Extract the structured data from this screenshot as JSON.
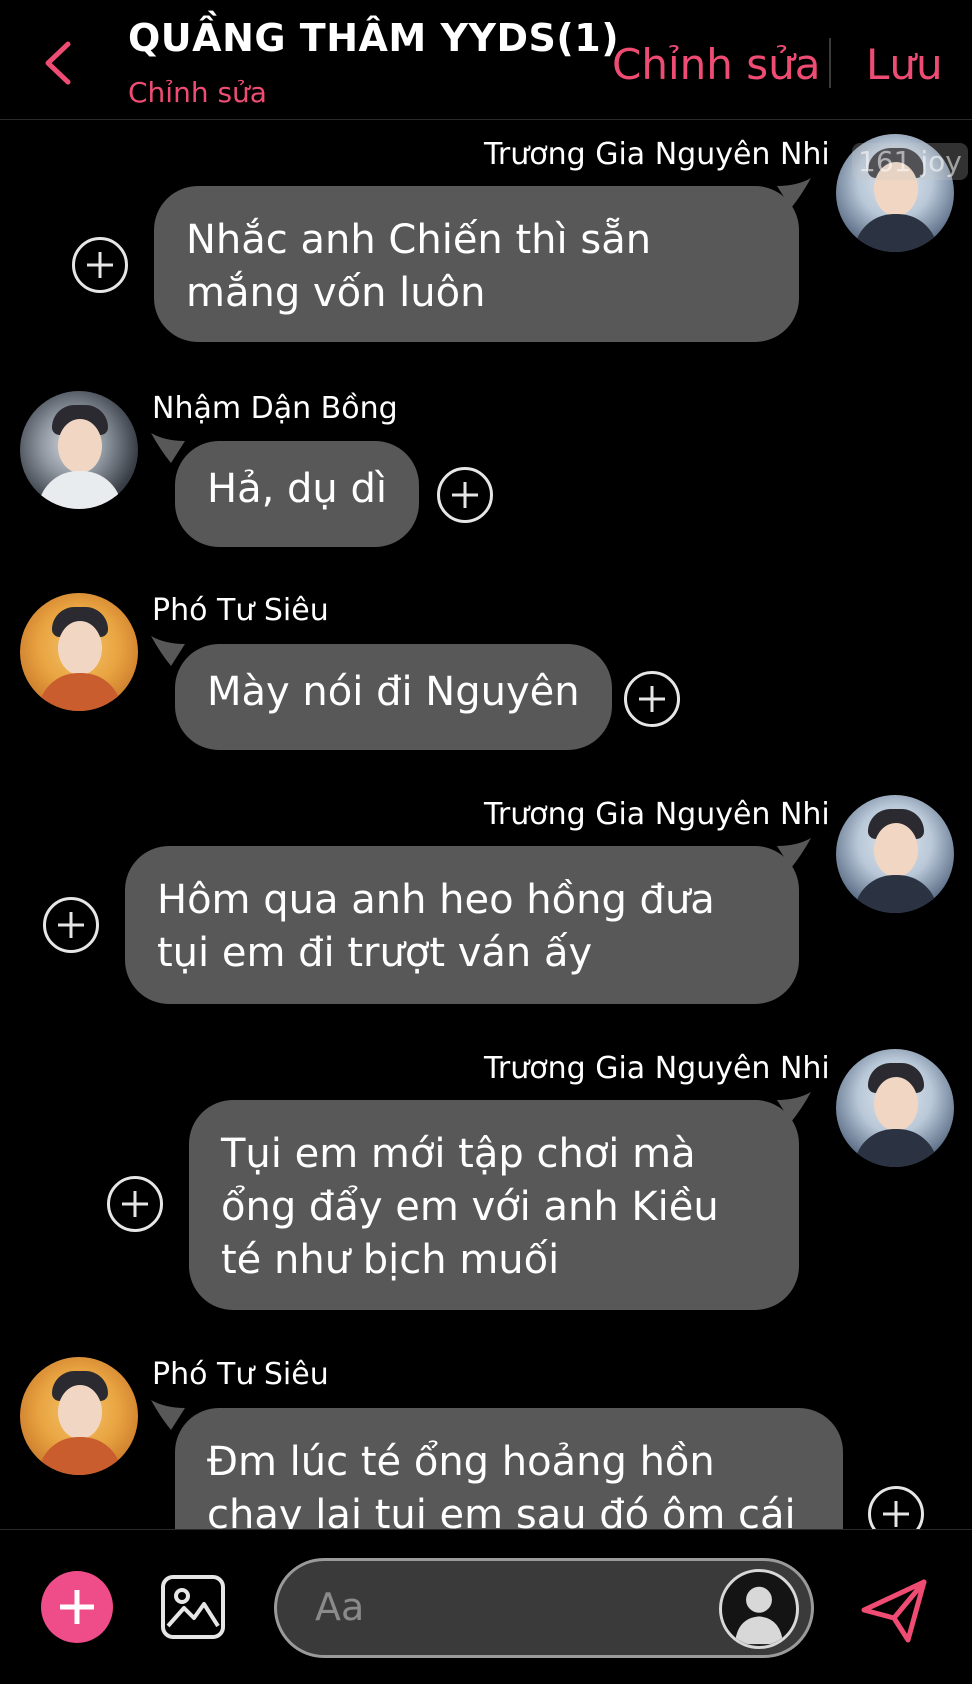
{
  "header": {
    "title": "QUẦNG THÂM YYDS(1)",
    "subtitle": "Chỉnh sửa",
    "edit_label": "Chỉnh sửa",
    "save_label": "Lưu",
    "accent_color": "#ef4c73"
  },
  "watermark": "161 joy",
  "messages": [
    {
      "side": "right",
      "sender": "Trương Gia Nguyên Nhi",
      "text": "Nhắc anh Chiến thì sẵn mắng vốn luôn"
    },
    {
      "side": "left",
      "sender": "Nhậm Dận Bồng",
      "text": "Hả, dụ dì"
    },
    {
      "side": "left",
      "sender": "Phó Tư Siêu",
      "text": "Mày nói đi Nguyên"
    },
    {
      "side": "right",
      "sender": "Trương Gia Nguyên Nhi",
      "text": "Hôm qua anh heo hồng đưa tụi em đi trượt ván ấy"
    },
    {
      "side": "right",
      "sender": "Trương Gia Nguyên Nhi",
      "text": "Tụi em mới tập chơi mà ổng đẩy em với anh Kiều té như bịch muối"
    },
    {
      "side": "left",
      "sender": "Phó Tư Siêu",
      "text": "Đm lúc té ổng hoảng hồn chạy lại tụi em sau đó ôm cái ván"
    }
  ],
  "composer": {
    "placeholder": "Aa",
    "add_icon": "plus-icon",
    "image_icon": "image-icon",
    "send_icon": "send-icon"
  }
}
